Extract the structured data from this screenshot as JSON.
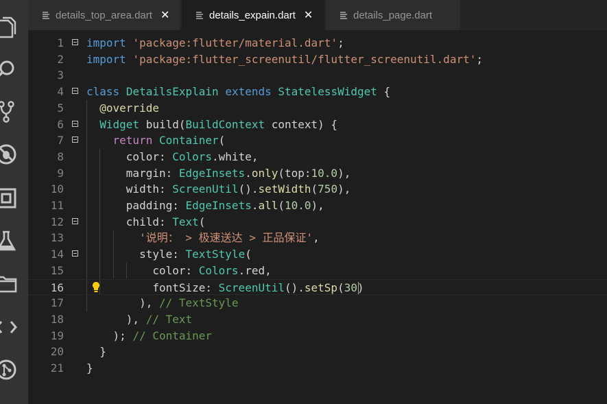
{
  "tabs": [
    {
      "label": "details_top_area.dart",
      "close": "✕",
      "active": false
    },
    {
      "label": "details_expain.dart",
      "close": "✕",
      "active": true
    },
    {
      "label": "details_page.dart",
      "active": false
    }
  ],
  "activity_icons": [
    "files-icon",
    "search-icon",
    "source-control-icon",
    "debug-icon",
    "extensions-icon",
    "flask-icon",
    "folder-icon",
    "code-icon",
    "git-icon"
  ],
  "current_line": 16,
  "lines": [
    {
      "n": "1",
      "tokens": [
        [
          "k",
          "import"
        ],
        [
          "v",
          " "
        ],
        [
          "s",
          "'package:flutter/material.dart'"
        ],
        [
          "v",
          ";"
        ]
      ]
    },
    {
      "n": "2",
      "tokens": [
        [
          "k",
          "import"
        ],
        [
          "v",
          " "
        ],
        [
          "s",
          "'package:flutter_screenutil/flutter_screenutil.dart'"
        ],
        [
          "v",
          ";"
        ]
      ]
    },
    {
      "n": "3",
      "tokens": []
    },
    {
      "n": "4",
      "tokens": [
        [
          "k",
          "class"
        ],
        [
          "v",
          " "
        ],
        [
          "t",
          "DetailsExplain"
        ],
        [
          "v",
          " "
        ],
        [
          "k",
          "extends"
        ],
        [
          "v",
          " "
        ],
        [
          "t",
          "StatelessWidget"
        ],
        [
          "v",
          " {"
        ]
      ]
    },
    {
      "n": "5",
      "tokens": [
        [
          "v",
          "  "
        ],
        [
          "f",
          "@override"
        ]
      ]
    },
    {
      "n": "6",
      "tokens": [
        [
          "v",
          "  "
        ],
        [
          "t",
          "Widget"
        ],
        [
          "v",
          " build("
        ],
        [
          "t",
          "BuildContext"
        ],
        [
          "v",
          " context) {"
        ]
      ]
    },
    {
      "n": "7",
      "tokens": [
        [
          "v",
          "    "
        ],
        [
          "a",
          "return"
        ],
        [
          "v",
          " "
        ],
        [
          "t",
          "Container"
        ],
        [
          "v",
          "("
        ]
      ]
    },
    {
      "n": "8",
      "tokens": [
        [
          "v",
          "      color: "
        ],
        [
          "t",
          "Colors"
        ],
        [
          "v",
          ".white,"
        ]
      ]
    },
    {
      "n": "9",
      "tokens": [
        [
          "v",
          "      margin: "
        ],
        [
          "t",
          "EdgeInsets"
        ],
        [
          "v",
          "."
        ],
        [
          "f",
          "only"
        ],
        [
          "v",
          "(top:"
        ],
        [
          "n",
          "10.0"
        ],
        [
          "v",
          "),"
        ]
      ]
    },
    {
      "n": "10",
      "tokens": [
        [
          "v",
          "      width: "
        ],
        [
          "t",
          "ScreenUtil"
        ],
        [
          "v",
          "()."
        ],
        [
          "f",
          "setWidth"
        ],
        [
          "v",
          "("
        ],
        [
          "n",
          "750"
        ],
        [
          "v",
          "),"
        ]
      ]
    },
    {
      "n": "11",
      "tokens": [
        [
          "v",
          "      padding: "
        ],
        [
          "t",
          "EdgeInsets"
        ],
        [
          "v",
          "."
        ],
        [
          "f",
          "all"
        ],
        [
          "v",
          "("
        ],
        [
          "n",
          "10.0"
        ],
        [
          "v",
          "),"
        ]
      ]
    },
    {
      "n": "12",
      "tokens": [
        [
          "v",
          "      child: "
        ],
        [
          "t",
          "Text"
        ],
        [
          "v",
          "("
        ]
      ]
    },
    {
      "n": "13",
      "tokens": [
        [
          "v",
          "        "
        ],
        [
          "s",
          "'说明： > 极速送达 > 正品保证'"
        ],
        [
          "v",
          ","
        ]
      ]
    },
    {
      "n": "14",
      "tokens": [
        [
          "v",
          "        style: "
        ],
        [
          "t",
          "TextStyle"
        ],
        [
          "v",
          "("
        ]
      ]
    },
    {
      "n": "15",
      "tokens": [
        [
          "v",
          "          color: "
        ],
        [
          "t",
          "Colors"
        ],
        [
          "v",
          ".red,"
        ]
      ]
    },
    {
      "n": "16",
      "tokens": [
        [
          "v",
          "          fontSize: "
        ],
        [
          "t",
          "ScreenUtil"
        ],
        [
          "v",
          "()."
        ],
        [
          "f",
          "setSp"
        ],
        [
          "v",
          "("
        ],
        [
          "n",
          "30"
        ],
        [
          "v",
          ")"
        ]
      ]
    },
    {
      "n": "17",
      "tokens": [
        [
          "v",
          "        ), "
        ],
        [
          "c",
          "// TextStyle"
        ]
      ]
    },
    {
      "n": "18",
      "tokens": [
        [
          "v",
          "      ), "
        ],
        [
          "c",
          "// Text"
        ]
      ]
    },
    {
      "n": "19",
      "tokens": [
        [
          "v",
          "    ); "
        ],
        [
          "c",
          "// Container"
        ]
      ]
    },
    {
      "n": "20",
      "tokens": [
        [
          "v",
          "  }"
        ]
      ]
    },
    {
      "n": "21",
      "tokens": [
        [
          "v",
          "}"
        ]
      ]
    }
  ],
  "fold_lines": [
    "1",
    "4",
    "6",
    "7",
    "12",
    "14"
  ],
  "lightbulb_line": "16"
}
